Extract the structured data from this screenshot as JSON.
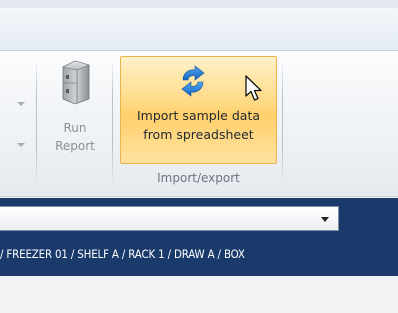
{
  "ribbon": {
    "run_report": {
      "label_line1": "Run",
      "label_line2": "Report"
    },
    "import_sample": {
      "label_line1": "Import sample data",
      "label_line2": "from spreadsheet"
    },
    "group_label": "Import/export"
  },
  "location_select": {
    "value": ""
  },
  "breadcrumb": {
    "text": "/ FREEZER 01 / SHELF A / RACK 1 / DRAW A / BOX"
  },
  "icons": [
    "mini-dropdown-arrow-icon",
    "freezer-icon",
    "sync-arrows-icon",
    "mouse-pointer-icon",
    "chevron-down-icon"
  ]
}
